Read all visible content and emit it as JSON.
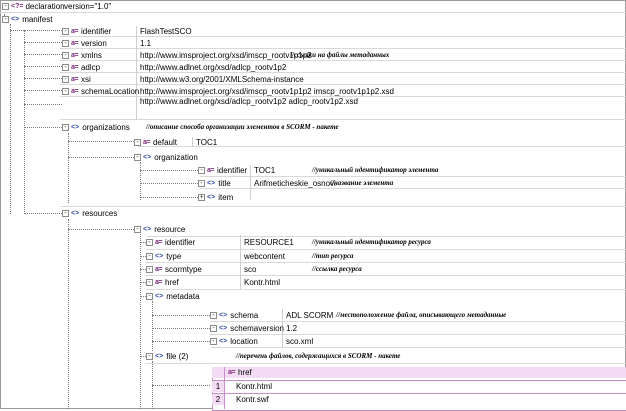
{
  "declaration": {
    "name": "declaration",
    "value": "version=\"1.0\""
  },
  "manifest": {
    "name": "manifest",
    "identifier": {
      "name": "identifier",
      "value": "FlashTestSCO"
    },
    "version": {
      "name": "version",
      "value": "1.1"
    },
    "xmlns": {
      "name": "xmlns",
      "value": "http://www.imsproject.org/xsd/imscp_rootv1p1p2",
      "note": "//ссылки на файлы метаданных"
    },
    "adlcp": {
      "name": "adlcp",
      "value": "http://www.adlnet.org/xsd/adlcp_rootv1p2"
    },
    "xsi": {
      "name": "xsi",
      "value": "http://www.w3.org/2001/XMLSchema-instance"
    },
    "schemaLocation": {
      "name": "schemaLocation",
      "value_line1": "http://www.imsproject.org/xsd/imscp_rootv1p1p2    imscp_rootv1p1p2.xsd",
      "value_line2": "http://www.adlnet.org/xsd/adlcp_rootv1p2 adlcp_rootv1p2.xsd"
    },
    "organizations": {
      "name": "organizations",
      "note": "//описание способа организации элементов в SCORM - пакете",
      "default": {
        "name": "default",
        "value": "TOC1"
      },
      "organization": {
        "name": "organization",
        "identifier": {
          "name": "identifier",
          "value": "TOC1",
          "note": "//уникальный идентификатор элемента"
        },
        "title": {
          "name": "title",
          "value": "Arifmeticheskie_osnovi",
          "note": "//название элемента"
        },
        "item": {
          "name": "item"
        }
      }
    },
    "resources": {
      "name": "resources",
      "resource": {
        "name": "resource",
        "identifier": {
          "name": "identifier",
          "value": "RESOURCE1",
          "note": "//уникальный идентификатор ресурса"
        },
        "type": {
          "name": "type",
          "value": "webcontent",
          "note": "//тип ресурса"
        },
        "scormtype": {
          "name": "scormtype",
          "value": "sco",
          "note": "//ссылка ресурса"
        },
        "href": {
          "name": "href",
          "value": "Kontr.html"
        },
        "metadata": {
          "name": "metadata",
          "schema": {
            "name": "schema",
            "value": "ADL SCORM",
            "note": "//местоположение файла, описывающего метаданные"
          },
          "schemaversion": {
            "name": "schemaversion",
            "value": "1.2"
          },
          "location": {
            "name": "location",
            "value": "sco.xml"
          }
        },
        "file": {
          "name": "file (2)",
          "note": "//перечень файлов, содержащихся в SCORM - пакете",
          "table_header": "href",
          "rows": [
            {
              "num": "1",
              "value": "Kontr.html"
            },
            {
              "num": "2",
              "value": "Kontr.swf"
            }
          ]
        }
      }
    }
  }
}
